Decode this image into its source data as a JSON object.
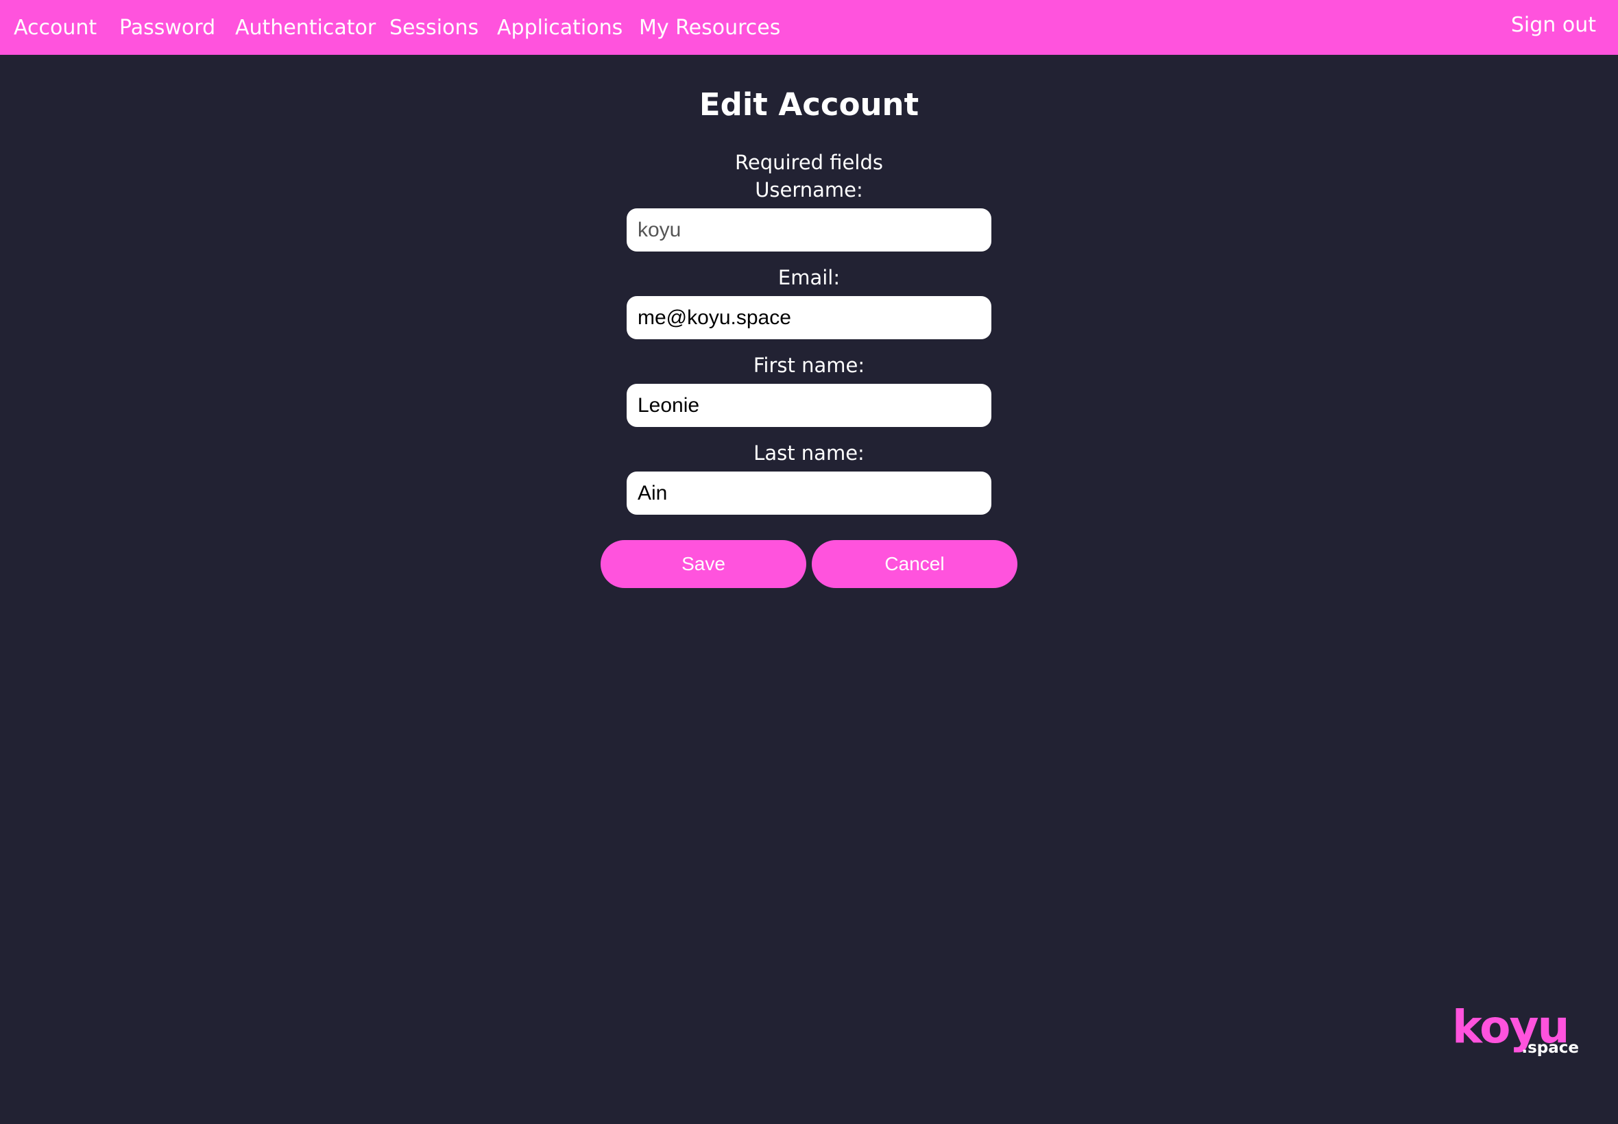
{
  "nav": {
    "items": [
      {
        "label": "Account"
      },
      {
        "label": "Password"
      },
      {
        "label": "Authenticator"
      },
      {
        "label": "Sessions"
      },
      {
        "label": "Applications"
      },
      {
        "label": "My Resources"
      }
    ],
    "sign_out": "Sign out"
  },
  "form": {
    "title": "Edit Account",
    "required_note": "Required fields",
    "username": {
      "label": "Username:",
      "value": "koyu"
    },
    "email": {
      "label": "Email:",
      "value": "me@koyu.space"
    },
    "first_name": {
      "label": "First name:",
      "value": "Leonie"
    },
    "last_name": {
      "label": "Last name:",
      "value": "Ain"
    },
    "save_label": "Save",
    "cancel_label": "Cancel"
  },
  "logo": {
    "main": "koyu",
    "sub": ".space"
  },
  "colors": {
    "accent": "#ff53dd",
    "background": "#222233",
    "text": "#ffffff",
    "field_background": "#ffffff"
  }
}
